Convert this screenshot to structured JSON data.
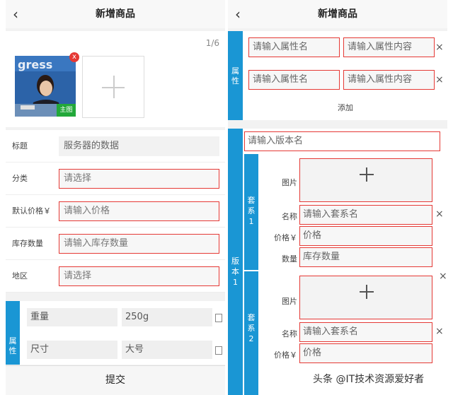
{
  "left": {
    "title": "新增商品",
    "image_count": "1/6",
    "delete_badge": "x",
    "main_tag": "主图",
    "rows": [
      {
        "label": "标题",
        "value": "服务器的数据"
      },
      {
        "label": "分类",
        "value": "请选择"
      },
      {
        "label": "默认价格￥",
        "value": "请输入价格"
      },
      {
        "label": "库存数量",
        "value": "请输入库存数量"
      },
      {
        "label": "地区",
        "value": "请选择"
      }
    ],
    "attr_tab": [
      "属",
      "性"
    ],
    "attrs": [
      {
        "name": "重量",
        "value": "250g"
      },
      {
        "name": "尺寸",
        "value": "大号"
      }
    ],
    "submit": "提交"
  },
  "right": {
    "title": "新增商品",
    "attr_tab": [
      "属",
      "性"
    ],
    "attrs": [
      {
        "name_placeholder": "请输入属性名",
        "value_placeholder": "请输入属性内容"
      },
      {
        "name_placeholder": "请输入属性名",
        "value_placeholder": "请输入属性内容"
      }
    ],
    "close": "×",
    "add": "添加",
    "version_name_placeholder": "请输入版本名",
    "version_tab": [
      "版",
      "本",
      "1"
    ],
    "sets": [
      {
        "tab": [
          "套",
          "系",
          "1"
        ],
        "image_label": "图片",
        "name_label": "名称",
        "name_placeholder": "请输入套系名",
        "price_label": "价格￥",
        "price_placeholder": "价格",
        "stock_label": "数量",
        "stock_placeholder": "库存数量"
      },
      {
        "tab": [
          "套",
          "系",
          "2"
        ],
        "image_label": "图片",
        "name_label": "名称",
        "name_placeholder": "请输入套系名",
        "price_label": "价格￥",
        "price_placeholder": "价格"
      }
    ]
  },
  "watermark": "头条 @IT技术资源爱好者"
}
